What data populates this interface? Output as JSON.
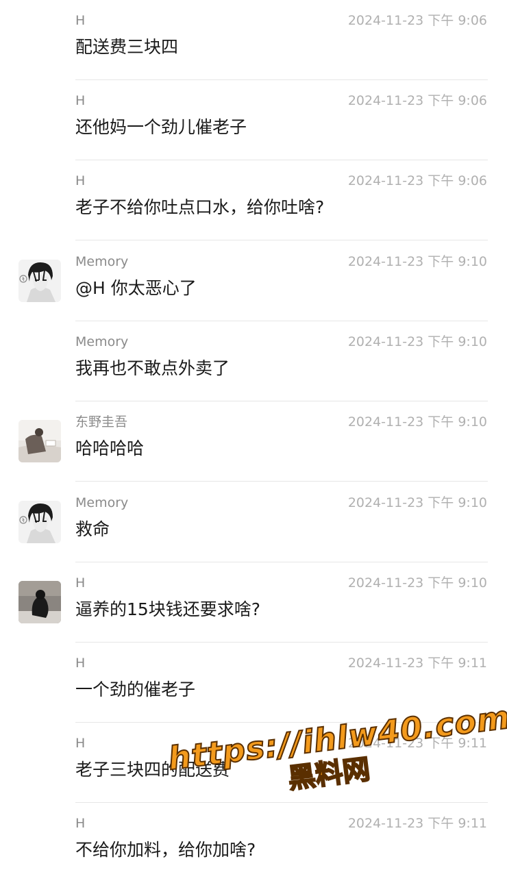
{
  "messages": [
    {
      "sender": "H",
      "time": "2024-11-23 下午 9:06",
      "text": "配送费三块四",
      "avatar": null
    },
    {
      "sender": "H",
      "time": "2024-11-23 下午 9:06",
      "text": "还他妈一个劲儿催老子",
      "avatar": null
    },
    {
      "sender": "H",
      "time": "2024-11-23 下午 9:06",
      "text": "老子不给你吐点口水，给你吐啥?",
      "avatar": null
    },
    {
      "sender": "Memory",
      "time": "2024-11-23 下午 9:10",
      "text": "@H 你太恶心了",
      "avatar": "memory-avatar"
    },
    {
      "sender": "Memory",
      "time": "2024-11-23 下午 9:10",
      "text": "我再也不敢点外卖了",
      "avatar": null
    },
    {
      "sender": "东野圭吾",
      "time": "2024-11-23 下午 9:10",
      "text": "哈哈哈哈",
      "avatar": "dongye-avatar"
    },
    {
      "sender": "Memory",
      "time": "2024-11-23 下午 9:10",
      "text": "救命",
      "avatar": "memory-avatar"
    },
    {
      "sender": "H",
      "time": "2024-11-23 下午 9:10",
      "text": "逼养的15块钱还要求啥?",
      "avatar": "h-avatar"
    },
    {
      "sender": "H",
      "time": "2024-11-23 下午 9:11",
      "text": "一个劲的催老子",
      "avatar": null
    },
    {
      "sender": "H",
      "time": "2024-11-23 下午 9:11",
      "text": "老子三块四的配送费",
      "avatar": null
    },
    {
      "sender": "H",
      "time": "2024-11-23 下午 9:11",
      "text": "不给你加料，给你加啥?",
      "avatar": null
    }
  ],
  "watermark": {
    "url": "https://ihlw40.com",
    "label": "黑料网"
  },
  "colors": {
    "name": "#8a8a8a",
    "time": "#b0b0b0",
    "text": "#1a1a1a",
    "divider": "#e6e6e6",
    "watermark": "#f39a1c"
  }
}
